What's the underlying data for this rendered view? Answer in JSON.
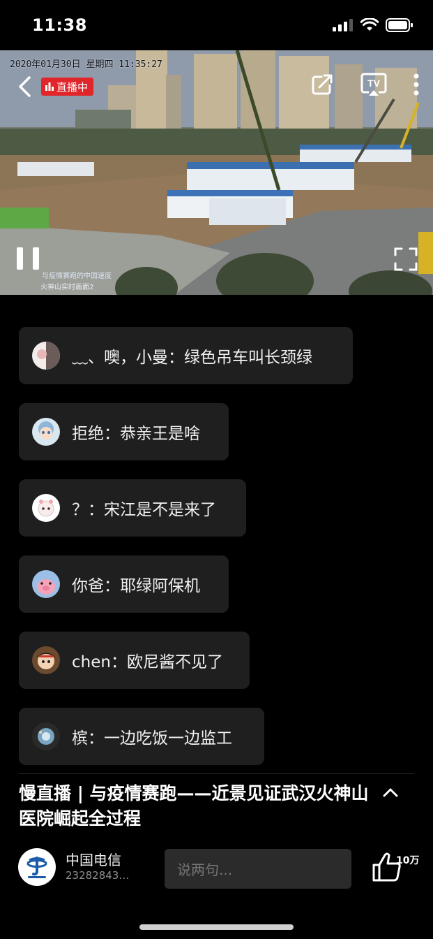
{
  "status_bar": {
    "time": "11:38"
  },
  "player": {
    "timestamp": "2020年01月30日 星期四 11:35:27",
    "live_badge": "直播中",
    "caption_line1": "与疫情赛跑的中国速度",
    "caption_line2": "火神山实时画面2",
    "controls": {
      "share_icon": "share-icon",
      "tv_icon": "tv-cast-icon",
      "more_icon": "more-vertical-icon",
      "fullscreen_icon": "fullscreen-icon",
      "pause_icon": "pause-icon",
      "back_icon": "chevron-left-icon"
    }
  },
  "comments": [
    {
      "text": "﹏、噢，小曼：绿色吊车叫长颈绿"
    },
    {
      "text": "拒绝：恭亲王是啥"
    },
    {
      "text": "？：宋江是不是来了"
    },
    {
      "text": "你爸：耶绿阿保机"
    },
    {
      "text": "chen：欧尼酱不见了"
    },
    {
      "text": "槟：一边吃饭一边监工"
    }
  ],
  "video_info": {
    "title": "慢直播 | 与疫情赛跑——近景见证武汉火神山医院崛起全过程"
  },
  "channel": {
    "name": "中国电信",
    "id": "23282843…"
  },
  "comment_input": {
    "placeholder": "说两句..."
  },
  "like": {
    "count": "10万"
  },
  "colors": {
    "live_red": "#e0262a",
    "chat_bubble": "#1f1f1f",
    "telecom_blue": "#1a5aa8"
  }
}
